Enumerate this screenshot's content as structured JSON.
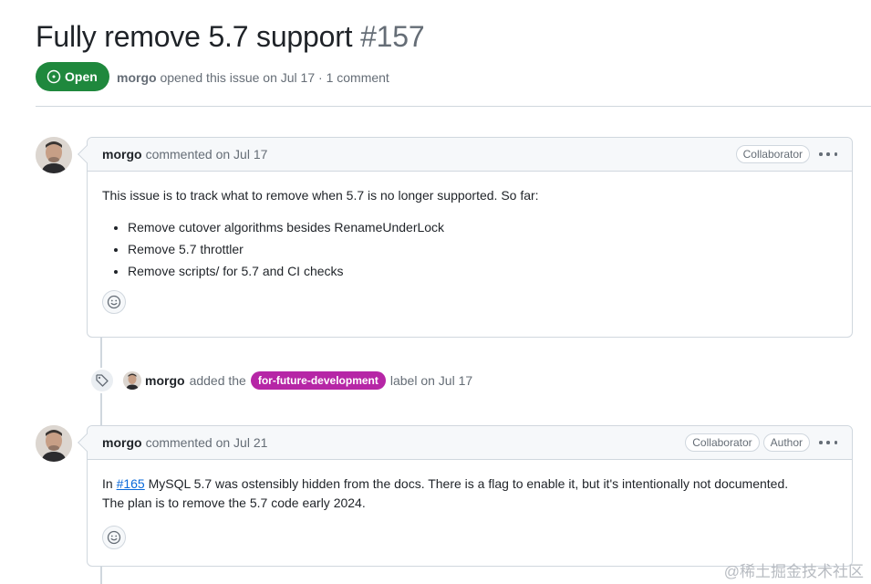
{
  "issue": {
    "title": "Fully remove 5.7 support",
    "number": "#157",
    "state": "Open",
    "author": "morgo",
    "meta_text": "opened this issue on Jul 17 · 1 comment"
  },
  "comments": [
    {
      "author": "morgo",
      "date_text": "commented on Jul 17",
      "badges": [
        "Collaborator"
      ],
      "intro": "This issue is to track what to remove when 5.7 is no longer supported. So far:",
      "items": [
        "Remove cutover algorithms besides RenameUnderLock",
        "Remove 5.7 throttler",
        "Remove scripts/ for 5.7 and CI checks"
      ]
    },
    {
      "author": "morgo",
      "date_text": "commented on Jul 21",
      "badges": [
        "Collaborator",
        "Author"
      ],
      "prefix": "In ",
      "link": "#165",
      "line1_rest": " MySQL 5.7 was ostensibly hidden from the docs. There is a flag to enable it, but it's intentionally not documented.",
      "line2": "The plan is to remove the 5.7 code early 2024."
    }
  ],
  "event": {
    "actor": "morgo",
    "action": "added the",
    "label": "for-future-development",
    "suffix": "label on Jul 17",
    "label_color": "#b626a6"
  },
  "watermark": "@稀土掘金技术社区",
  "colors": {
    "open_green": "#1f883d",
    "link_blue": "#0969da"
  }
}
